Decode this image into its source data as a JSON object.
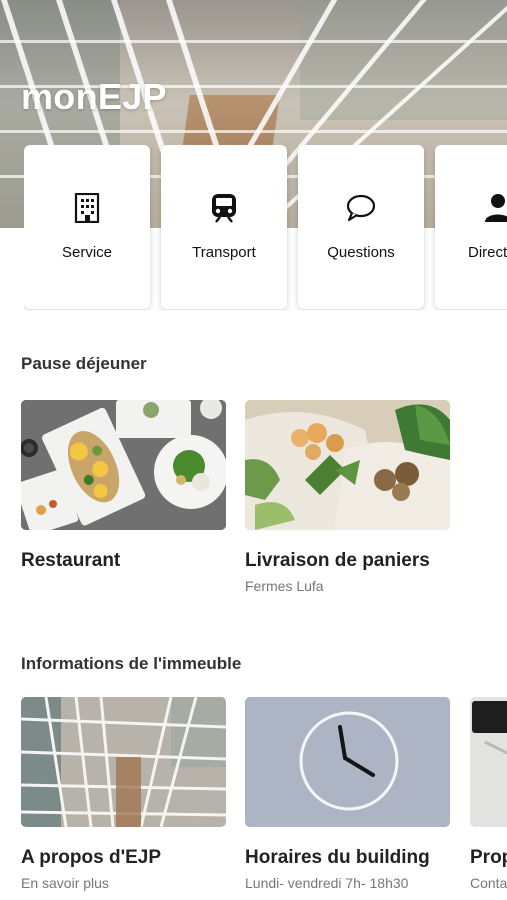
{
  "app": {
    "title": "monEJP"
  },
  "quick_actions": [
    {
      "label": "Service",
      "icon": "building-icon"
    },
    {
      "label": "Transport",
      "icon": "train-icon"
    },
    {
      "label": "Questions",
      "icon": "chat-bubble-icon"
    },
    {
      "label": "Directory",
      "icon": "person-icon"
    }
  ],
  "lunch": {
    "title": "Pause déjeuner",
    "cards": [
      {
        "title": "Restaurant",
        "subtitle": ""
      },
      {
        "title": "Livraison de paniers",
        "subtitle": "Fermes Lufa"
      }
    ]
  },
  "building": {
    "title": "Informations de l'immeuble",
    "cards": [
      {
        "title": "A propos d'EJP",
        "subtitle": "En savoir plus"
      },
      {
        "title": "Horaires du building",
        "subtitle": "Lundi- vendredi 7h- 18h30"
      },
      {
        "title": "Propriété",
        "subtitle": "Contact"
      }
    ]
  }
}
